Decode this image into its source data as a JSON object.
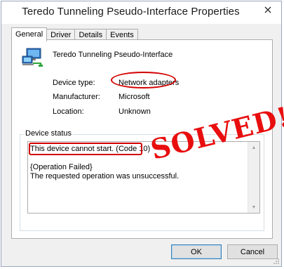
{
  "window": {
    "title": "Teredo Tunneling Pseudo-Interface Properties"
  },
  "tabs": [
    {
      "label": "General",
      "active": true
    },
    {
      "label": "Driver",
      "active": false
    },
    {
      "label": "Details",
      "active": false
    },
    {
      "label": "Events",
      "active": false
    }
  ],
  "device": {
    "name": "Teredo Tunneling Pseudo-Interface",
    "icon": "network-adapter-icon",
    "properties": [
      {
        "label": "Device type:",
        "value": "Network adapters"
      },
      {
        "label": "Manufacturer:",
        "value": "Microsoft"
      },
      {
        "label": "Location:",
        "value": "Unknown"
      }
    ]
  },
  "status": {
    "group_label": "Device status",
    "lines": [
      "This device cannot start. (Code 10)",
      "",
      "{Operation Failed}",
      "The requested operation was unsuccessful."
    ]
  },
  "stamp": {
    "text": "SOLVED!",
    "color": "#e80e0e"
  },
  "annotation_color": "#d40000",
  "buttons": {
    "ok": "OK",
    "cancel": "Cancel"
  }
}
